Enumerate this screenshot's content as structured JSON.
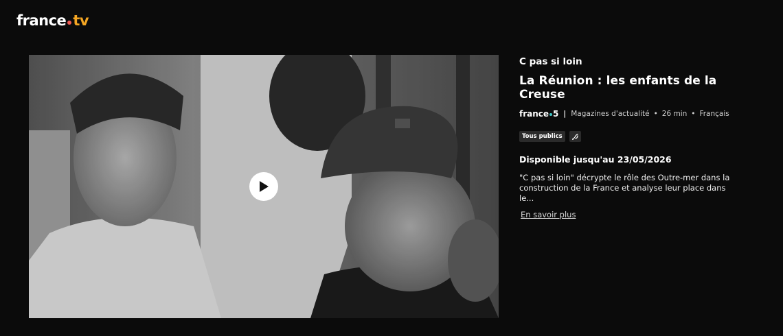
{
  "header": {
    "logo_text_left": "france",
    "logo_text_right": "tv",
    "logo_dot_color": "#f25c54"
  },
  "player": {
    "play_icon": "play-icon"
  },
  "program": {
    "show_title": "C pas si loin",
    "episode_title": "La Réunion : les enfants de la Creuse",
    "channel_name": "france",
    "channel_number": "5",
    "separator": "|",
    "genre": "Magazines d'actualité",
    "duration": "26 min",
    "language": "Français",
    "bullet": "•",
    "rating_badge": "Tous publics",
    "accessibility_icon": "audio-description-icon",
    "availability": "Disponible jusqu'au 23/05/2026",
    "description": "\"C pas si loin\" décrypte le rôle des Outre-mer dans la construction de la France et analyse leur place dans le...",
    "more_link": "En savoir plus"
  },
  "colors": {
    "background": "#0b0b0b",
    "accent_orange": "#f5a623",
    "channel_dot": "#3ec6c6"
  }
}
